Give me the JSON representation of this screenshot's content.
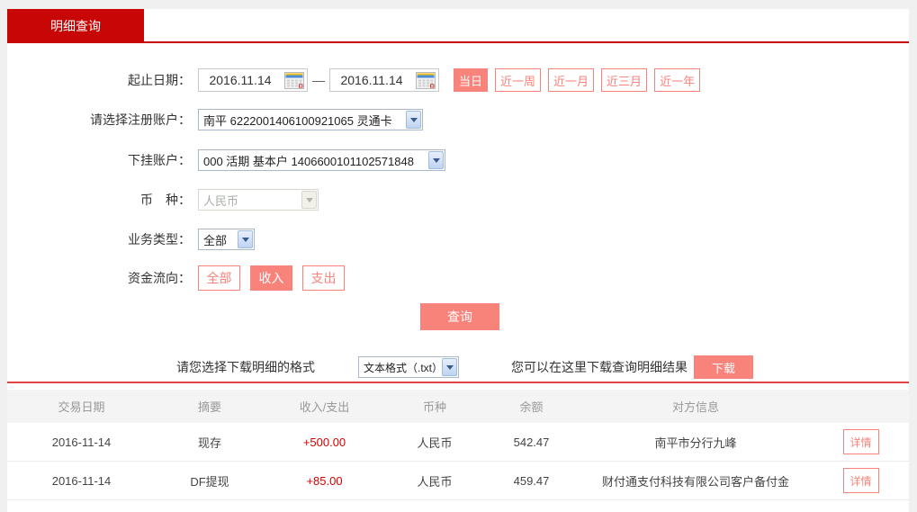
{
  "tab": {
    "label": "明细查询"
  },
  "form": {
    "date": {
      "label": "起止日期：",
      "start": "2016.11.14",
      "separator": "—",
      "end": "2016.11.14",
      "quick_buttons": [
        {
          "label": "当日",
          "active": true
        },
        {
          "label": "近一周",
          "active": false
        },
        {
          "label": "近一月",
          "active": false
        },
        {
          "label": "近三月",
          "active": false
        },
        {
          "label": "近一年",
          "active": false
        }
      ]
    },
    "registered_account": {
      "label": "请选择注册账户：",
      "value": "南平 6222001406100921065 灵通卡"
    },
    "linked_account": {
      "label": "下挂账户：",
      "value": "000 活期 基本户 1406600101102571848"
    },
    "currency": {
      "label": "币　种：",
      "value": "人民币",
      "disabled": true
    },
    "business_type": {
      "label": "业务类型：",
      "value": "全部"
    },
    "fund_flow": {
      "label": "资金流向：",
      "options": [
        {
          "label": "全部",
          "active": false
        },
        {
          "label": "收入",
          "active": true
        },
        {
          "label": "支出",
          "active": false
        }
      ]
    },
    "query_button": "查询"
  },
  "download": {
    "format_label": "请您选择下载明细的格式",
    "format_value": "文本格式（.txt）",
    "hint": "您可以在这里下载查询明细结果",
    "button": "下载"
  },
  "table": {
    "headers": [
      "交易日期",
      "摘要",
      "收入/支出",
      "币种",
      "余额",
      "对方信息"
    ],
    "detail_label": "详情",
    "rows": [
      {
        "date": "2016-11-14",
        "summary": "现存",
        "amount": "+500.00",
        "currency": "人民币",
        "balance": "542.47",
        "counterparty": "南平市分行九峰"
      },
      {
        "date": "2016-11-14",
        "summary": "DF提现",
        "amount": "+85.00",
        "currency": "人民币",
        "balance": "459.47",
        "counterparty": "财付通支付科技有限公司客户备付金"
      }
    ]
  },
  "colors": {
    "brand_red": "#c90606",
    "accent_salmon": "#f8837b",
    "amount_red": "#d40000",
    "table_line_red": "#e04343"
  }
}
